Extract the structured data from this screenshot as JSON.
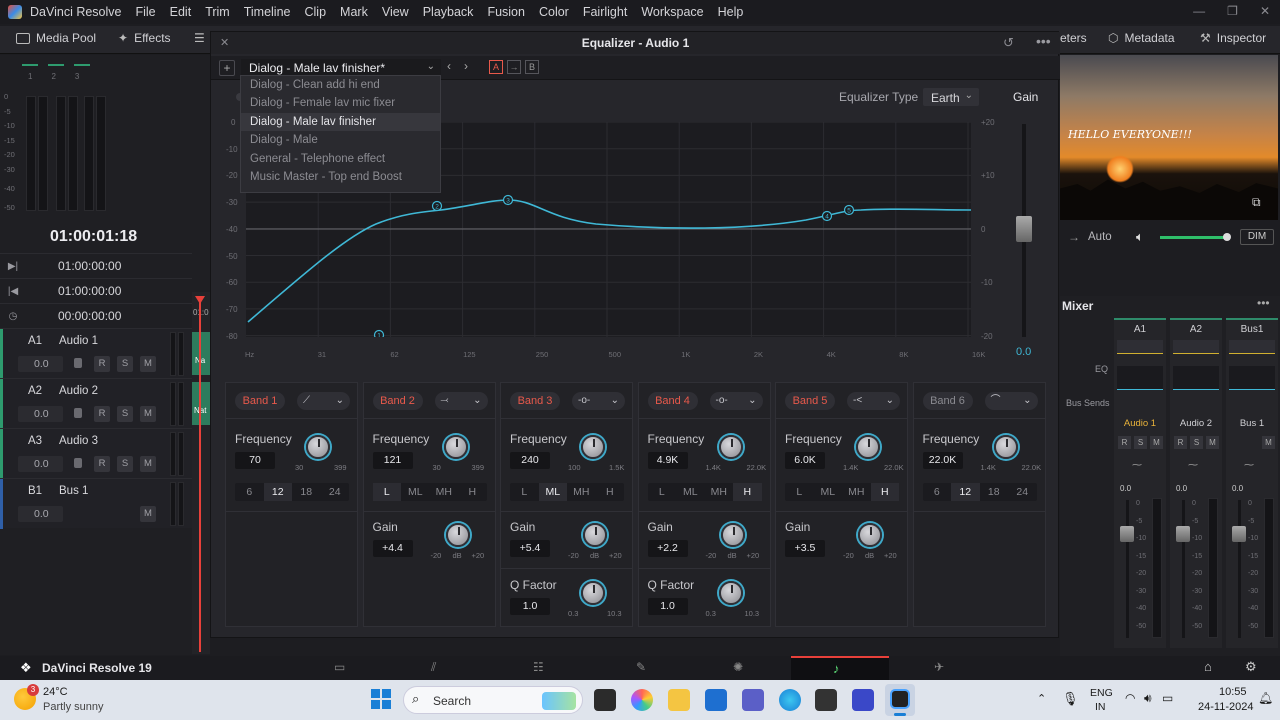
{
  "menubar": {
    "app": "DaVinci Resolve",
    "items": [
      "File",
      "Edit",
      "Trim",
      "Timeline",
      "Clip",
      "Mark",
      "View",
      "Playback",
      "Fusion",
      "Color",
      "Fairlight",
      "Workspace",
      "Help"
    ]
  },
  "toolbar": {
    "media_pool": "Media Pool",
    "effects": "Effects",
    "meters_partial": "eters",
    "metadata": "Metadata",
    "inspector": "Inspector"
  },
  "left": {
    "meter_labels": [
      "1",
      "2",
      "3"
    ],
    "db_scale": [
      "0",
      "-5",
      "-10",
      "-15",
      "-20",
      "-30",
      "-40",
      "-50"
    ],
    "timecode": "01:00:01:18",
    "tc_rows": [
      "01:00:00:00",
      "01:00:00:00",
      "00:00:00:00"
    ],
    "tracks": [
      {
        "id": "A1",
        "name": "Audio 1",
        "vol": "0.0"
      },
      {
        "id": "A2",
        "name": "Audio 2",
        "vol": "0.0"
      },
      {
        "id": "A3",
        "name": "Audio 3",
        "vol": "0.0"
      },
      {
        "id": "B1",
        "name": "Bus 1",
        "vol": "0.0"
      }
    ],
    "timeline_clip_a": "Na",
    "timeline_clip_b": "Nat",
    "playhead_label": "01:0"
  },
  "eq": {
    "title": "Equalizer - Audio 1",
    "preset_current": "Dialog - Male lav finisher*",
    "ab_a": "A",
    "ab_b": "B",
    "presets": [
      "Dialog - Clean add hi end",
      "Dialog - Female lav mic fixer",
      "Dialog - Male lav finisher",
      "Dialog - Male",
      "General - Telephone effect",
      "Music Master - Top end Boost"
    ],
    "selected_preset_index": 2,
    "eq_type_label": "Equalizer Type",
    "eq_type_value": "Earth",
    "gain_label": "Gain",
    "gain_value": "0.0",
    "y_left_ticks": [
      "0",
      "-10",
      "-20",
      "-30",
      "-40",
      "-50",
      "-60",
      "-70",
      "-80"
    ],
    "y_right_ticks": [
      "+20",
      "+10",
      "0",
      "-10",
      "-20"
    ],
    "x_ticks": [
      "Hz",
      "31",
      "62",
      "125",
      "250",
      "500",
      "1K",
      "2K",
      "4K",
      "8K",
      "16K"
    ],
    "curve_nodes": [
      "1",
      "2",
      "3",
      "4",
      "5"
    ],
    "bands": [
      {
        "label": "Band 1",
        "active": true,
        "freq_label": "Frequency",
        "freq": "70",
        "freq_min": "30",
        "freq_max": "399",
        "seg": [
          "6",
          "12",
          "18",
          "24"
        ],
        "seg_on": "12",
        "has_gain": false,
        "has_q": false
      },
      {
        "label": "Band 2",
        "active": true,
        "freq_label": "Frequency",
        "freq": "121",
        "freq_min": "30",
        "freq_max": "399",
        "seg": [
          "L",
          "ML",
          "MH",
          "H"
        ],
        "seg_on": "L",
        "has_gain": true,
        "gain_label": "Gain",
        "gain": "+4.4",
        "gain_min": "-20",
        "gain_unit": "dB",
        "gain_max": "+20",
        "has_q": false
      },
      {
        "label": "Band 3",
        "active": true,
        "freq_label": "Frequency",
        "freq": "240",
        "freq_min": "100",
        "freq_max": "1.5K",
        "seg": [
          "L",
          "ML",
          "MH",
          "H"
        ],
        "seg_on": "ML",
        "has_gain": true,
        "gain_label": "Gain",
        "gain": "+5.4",
        "gain_min": "-20",
        "gain_unit": "dB",
        "gain_max": "+20",
        "has_q": true,
        "q_label": "Q Factor",
        "q": "1.0",
        "q_min": "0.3",
        "q_max": "10.3"
      },
      {
        "label": "Band 4",
        "active": true,
        "freq_label": "Frequency",
        "freq": "4.9K",
        "freq_min": "1.4K",
        "freq_max": "22.0K",
        "seg": [
          "L",
          "ML",
          "MH",
          "H"
        ],
        "seg_on": "H",
        "has_gain": true,
        "gain_label": "Gain",
        "gain": "+2.2",
        "gain_min": "-20",
        "gain_unit": "dB",
        "gain_max": "+20",
        "has_q": true,
        "q_label": "Q Factor",
        "q": "1.0",
        "q_min": "0.3",
        "q_max": "10.3"
      },
      {
        "label": "Band 5",
        "active": true,
        "freq_label": "Frequency",
        "freq": "6.0K",
        "freq_min": "1.4K",
        "freq_max": "22.0K",
        "seg": [
          "L",
          "ML",
          "MH",
          "H"
        ],
        "seg_on": "H",
        "has_gain": true,
        "gain_label": "Gain",
        "gain": "+3.5",
        "gain_min": "-20",
        "gain_unit": "dB",
        "gain_max": "+20",
        "has_q": false
      },
      {
        "label": "Band 6",
        "active": false,
        "freq_label": "Frequency",
        "freq": "22.0K",
        "freq_min": "1.4K",
        "freq_max": "22.0K",
        "seg": [
          "6",
          "12",
          "18",
          "24"
        ],
        "seg_on": "12",
        "has_gain": false,
        "has_q": false
      }
    ]
  },
  "viewer": {
    "overlay_text": "HELLO EVERYONE!!!",
    "auto_label": "Auto",
    "dim_label": "DIM"
  },
  "mixer": {
    "title": "Mixer",
    "columns": [
      "A1",
      "A2",
      "Bus1"
    ],
    "eq_label": "EQ",
    "bus_sends_label": "Bus Sends",
    "strip_names": [
      "Audio 1",
      "Audio 2",
      "Bus 1"
    ],
    "fader_values": [
      "0.0",
      "0.0",
      "0.0"
    ],
    "scale": [
      "0",
      "-5",
      "-10",
      "-15",
      "-20",
      "-30",
      "-40",
      "-50"
    ]
  },
  "pagebar": {
    "app_name": "DaVinci Resolve 19"
  },
  "taskbar": {
    "weather_temp": "24°C",
    "weather_desc": "Partly sunny",
    "weather_badge": "3",
    "search_placeholder": "Search",
    "lang_top": "ENG",
    "lang_bottom": "IN",
    "time": "10:55",
    "date": "24-11-2024"
  },
  "colors": {
    "accent_cyan": "#3fb8d6",
    "band_red": "#e8594b",
    "playhead": "#e8403a",
    "track_green": "#2e9b6e"
  }
}
